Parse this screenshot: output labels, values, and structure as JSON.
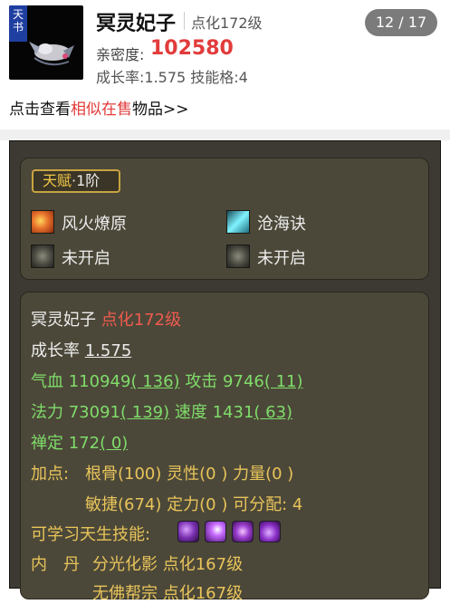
{
  "item": {
    "badge_text_1": "天",
    "badge_text_2": "书",
    "name": "冥灵妃子",
    "dianhua_level": "点化172级",
    "page": "12 / 17",
    "qinmi_label": "亲密度:",
    "qinmi_value": "102580",
    "growth_line": "成长率:1.575 技能格:4"
  },
  "similar_link": {
    "prefix": "点击查看",
    "highlight": "相似在售",
    "suffix": "物品>>"
  },
  "talent": {
    "badge_gold": "天赋",
    "badge_rank": "·1阶",
    "skills": [
      {
        "icon": "fire-skill-icon",
        "label": "风火燎原"
      },
      {
        "icon": "sea-skill-icon",
        "label": "沧海诀"
      },
      {
        "icon": "locked-skill-icon",
        "label": "未开启"
      },
      {
        "icon": "locked-skill-icon",
        "label": "未开启"
      }
    ]
  },
  "stats": {
    "name": "冥灵妃子",
    "dianhua": "点化172级",
    "growth_label": "成长率",
    "growth_value": "1.575",
    "qixue_label": "气血",
    "qixue_value": "110949",
    "qixue_add": "( 136)",
    "gongji_label": "攻击",
    "gongji_value": "9746",
    "gongji_add": "( 11)",
    "fali_label": "法力",
    "fali_value": "73091",
    "fali_add": "( 139)",
    "sudu_label": "速度",
    "sudu_value": "1431",
    "sudu_add": "( 63)",
    "chanding_label": "禅定",
    "chanding_value": "172",
    "chanding_add": "( 0)",
    "jiadian_label": "加点:",
    "jiadian_line1": "根骨(100) 灵性(0 ) 力量(0 )",
    "jiadian_line2": "敏捷(674) 定力(0 ) 可分配: 4",
    "innate_label": "可学习天生技能:",
    "neidan_label": "内　丹",
    "neidan_1": "分光化影 点化167级",
    "neidan_2": "无佛帮宗 点化167级"
  },
  "colors": {
    "accent_red": "#e23b3b",
    "stat_green": "#7fdc6a",
    "gold": "#f3c648",
    "panel_bg": "#4c4839"
  }
}
